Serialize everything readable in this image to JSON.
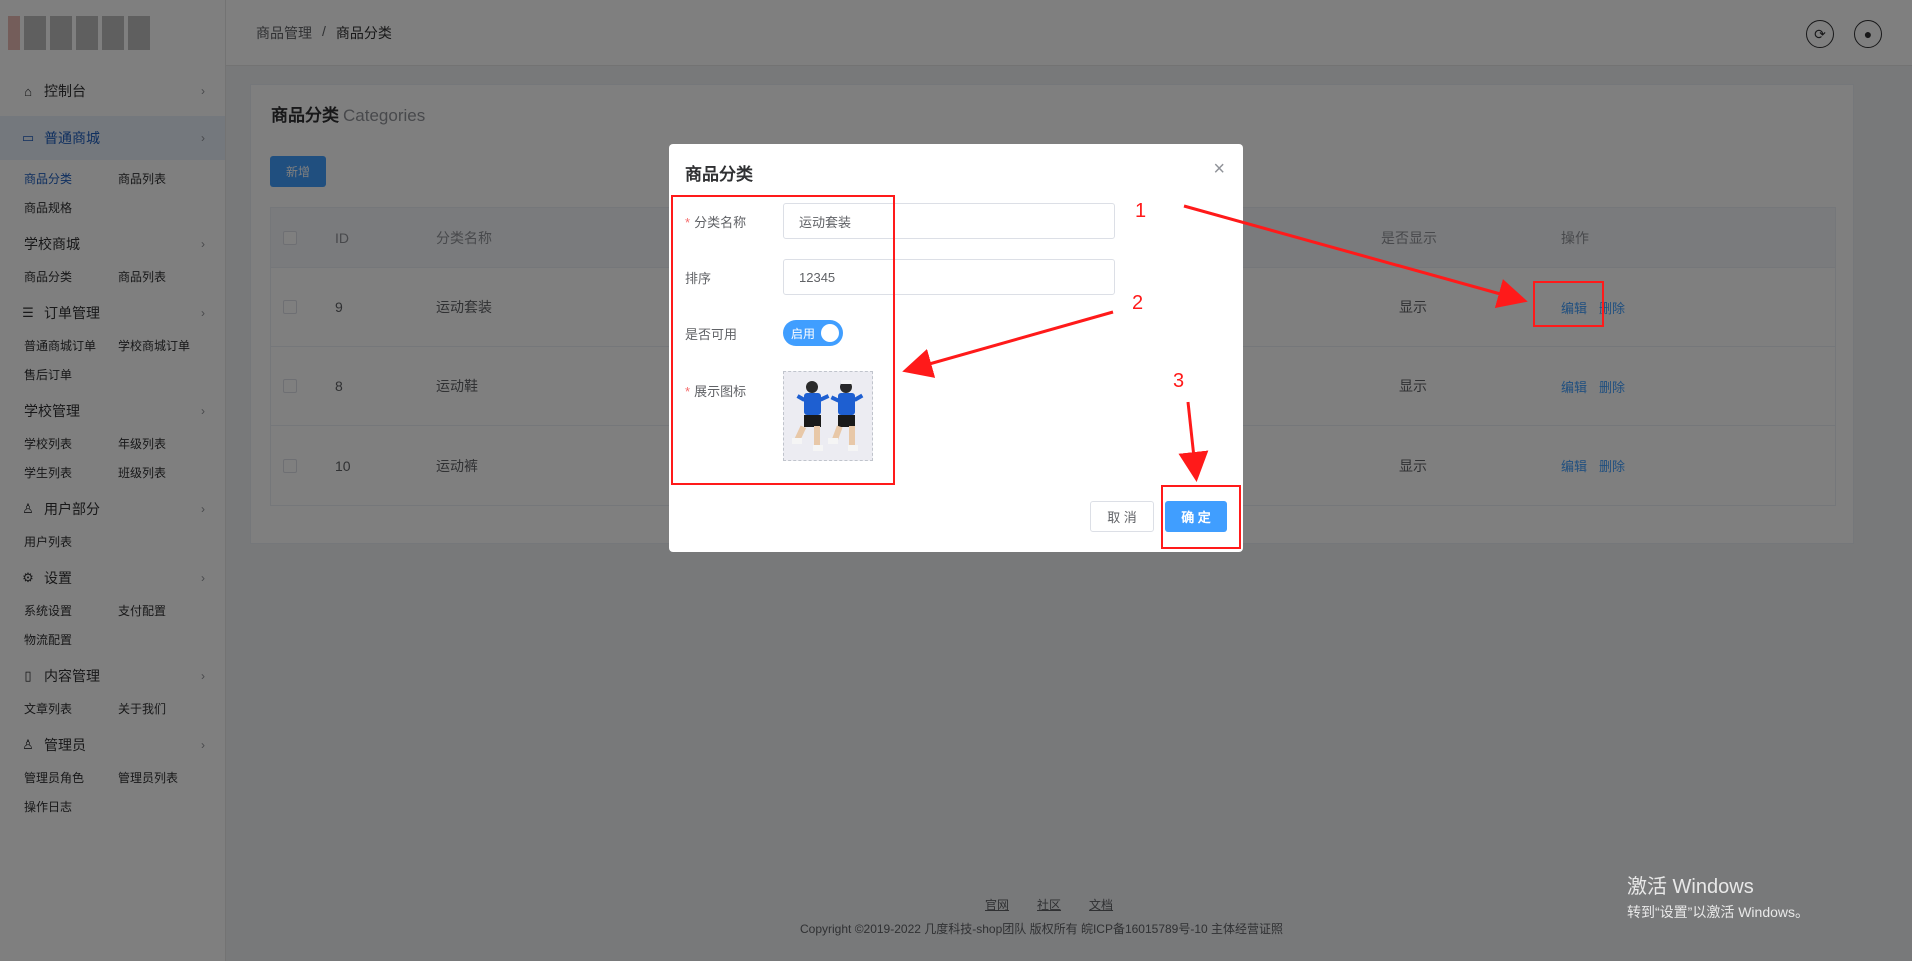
{
  "sidebar": {
    "groups": [
      {
        "label": "控制台",
        "icon": "home-icon",
        "items": []
      },
      {
        "label": "普通商城",
        "icon": "shop-icon",
        "active": true,
        "items": [
          "商品分类",
          "商品列表",
          "商品规格"
        ]
      },
      {
        "label": "学校商城",
        "icon": "",
        "items": [
          "商品分类",
          "商品列表"
        ]
      },
      {
        "label": "订单管理",
        "icon": "list-icon",
        "items": [
          "普通商城订单",
          "学校商城订单",
          "售后订单"
        ]
      },
      {
        "label": "学校管理",
        "icon": "",
        "items": [
          "学校列表",
          "年级列表",
          "学生列表",
          "班级列表"
        ]
      },
      {
        "label": "用户部分",
        "icon": "user-icon",
        "items": [
          "用户列表"
        ]
      },
      {
        "label": "设置",
        "icon": "gear-icon",
        "items": [
          "系统设置",
          "支付配置",
          "物流配置"
        ]
      },
      {
        "label": "内容管理",
        "icon": "document-icon",
        "items": [
          "文章列表",
          "关于我们"
        ]
      },
      {
        "label": "管理员",
        "icon": "admin-icon",
        "items": [
          "管理员角色",
          "管理员列表",
          "操作日志"
        ]
      }
    ]
  },
  "header": {
    "breadcrumb": [
      "商品管理",
      "/",
      "商品分类"
    ]
  },
  "page": {
    "title": "商品分类",
    "title_en": "Categories",
    "add_label": "新增"
  },
  "table": {
    "headers": {
      "id": "ID",
      "name": "分类名称",
      "show": "是否显示",
      "op": "操作"
    },
    "rows": [
      {
        "id": "9",
        "name": "运动套装",
        "show": "显示",
        "edit": "编辑",
        "delete": "删除"
      },
      {
        "id": "8",
        "name": "运动鞋",
        "show": "显示",
        "edit": "编辑",
        "delete": "删除"
      },
      {
        "id": "10",
        "name": "运动裤",
        "show": "显示",
        "edit": "编辑",
        "delete": "删除"
      }
    ]
  },
  "footer": {
    "links": [
      "官网",
      "社区",
      "文档"
    ],
    "copyright": "Copyright ©2019-2022 几度科技-shop团队 版权所有 皖ICP备16015789号-10 主体经营证照"
  },
  "watermark": {
    "line1": "激活 Windows",
    "line2": "转到“设置”以激活 Windows。"
  },
  "dialog": {
    "title": "商品分类",
    "name_label": "分类名称",
    "name_value": "运动套装",
    "sort_label": "排序",
    "sort_value": "12345",
    "enable_label": "是否可用",
    "enable_text": "启用",
    "enabled": true,
    "icon_label": "展示图标",
    "cancel_label": "取 消",
    "ok_label": "确 定"
  },
  "annotations": {
    "n1": "1",
    "n2": "2",
    "n3": "3",
    "color": "#ff1a1a"
  },
  "colors": {
    "primary": "#409eff",
    "active_menu": "#1f5fbf"
  }
}
